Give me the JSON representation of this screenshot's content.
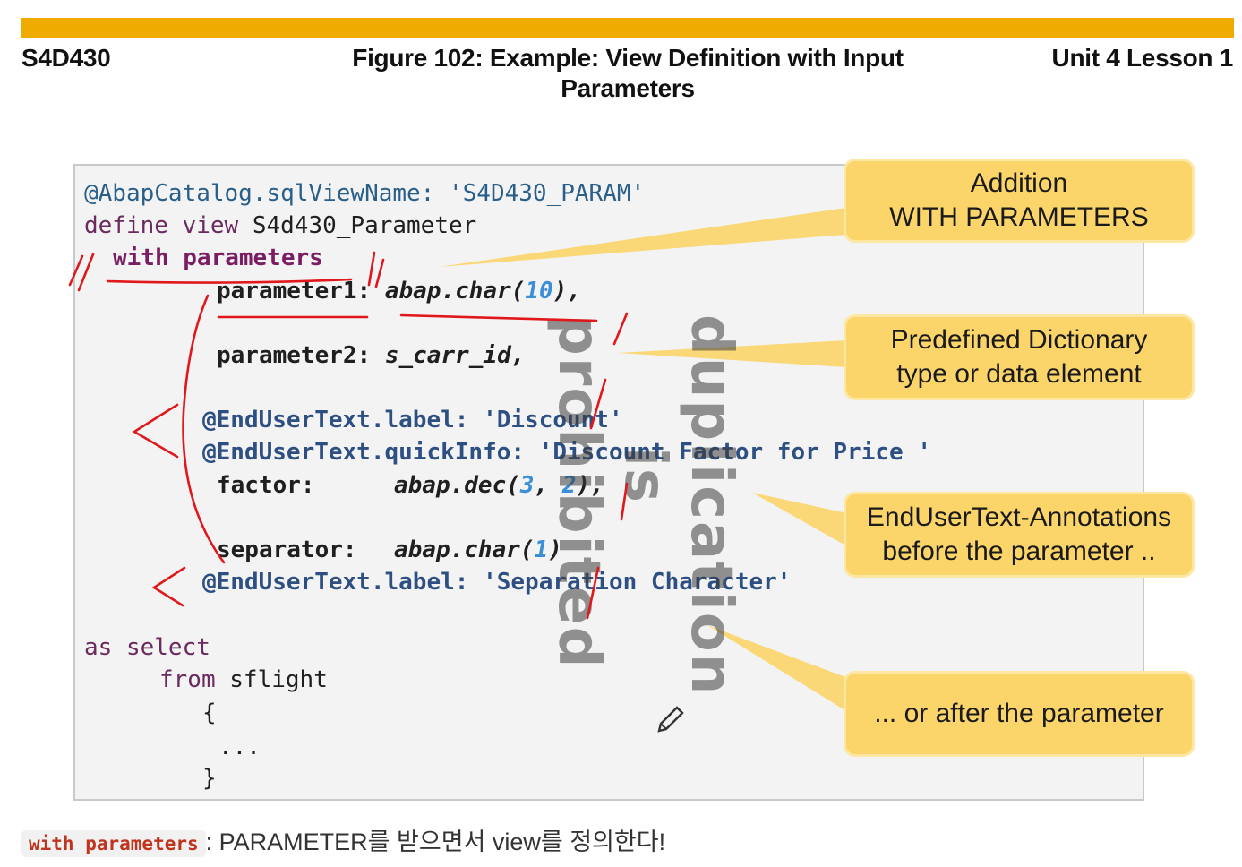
{
  "header": {
    "course": "S4D430",
    "figure_title_line1": "Figure 102: Example: View Definition with Input",
    "figure_title_line2": "Parameters",
    "unit": "Unit 4 Lesson 1"
  },
  "code": {
    "l1_anno": "@AbapCatalog.sqlViewName: ",
    "l1_str": "'S4D430_PARAM'",
    "l2_kw": "define view ",
    "l2_name": "S4d430_Parameter",
    "l3": "with parameters",
    "l4_name": "parameter1: ",
    "l4_t1": "abap",
    "l4_dot": ".",
    "l4_t2": "char(",
    "l4_num": "10",
    "l4_end": "),",
    "l5_name": "parameter2: ",
    "l5_type": "s_carr_id,",
    "l6_anno": "@EndUserText.label: ",
    "l6_str": "'Discount'",
    "l7_anno": "@EndUserText.quickInfo: ",
    "l7_str": "'Discount Factor for Price '",
    "l8_name": "factor:",
    "l8_t": "abap.dec(",
    "l8_n1": "3",
    "l8_c": ", ",
    "l8_n2": "2",
    "l8_end": "),",
    "l9_name": "separator:",
    "l9_t": "abap.char(",
    "l9_n": "1",
    "l9_end": ")",
    "l10_anno": "@EndUserText.label: ",
    "l10_str": "'Separation Character'",
    "l11": "as select",
    "l12_kw": "from ",
    "l12_tbl": "sflight",
    "l13": "{",
    "l14": "...",
    "l15": "}"
  },
  "callouts": {
    "c1_line1": "Addition",
    "c1_line2": "WITH PARAMETERS",
    "c2_line1": "Predefined Dictionary",
    "c2_line2": "type or data  element",
    "c3_line1": "EndUserText-Annotations",
    "c3_line2": "before the parameter ..",
    "c4_line1": "... or after the parameter"
  },
  "watermark": "duplication is prohibited",
  "footer": {
    "code": "with parameters",
    "text": ": PARAMETER를 받으면서 view를 정의한다!"
  },
  "colors": {
    "topbar": "#f0ab00",
    "callout": "#fbd56a",
    "handwriting": "#e0181b"
  }
}
